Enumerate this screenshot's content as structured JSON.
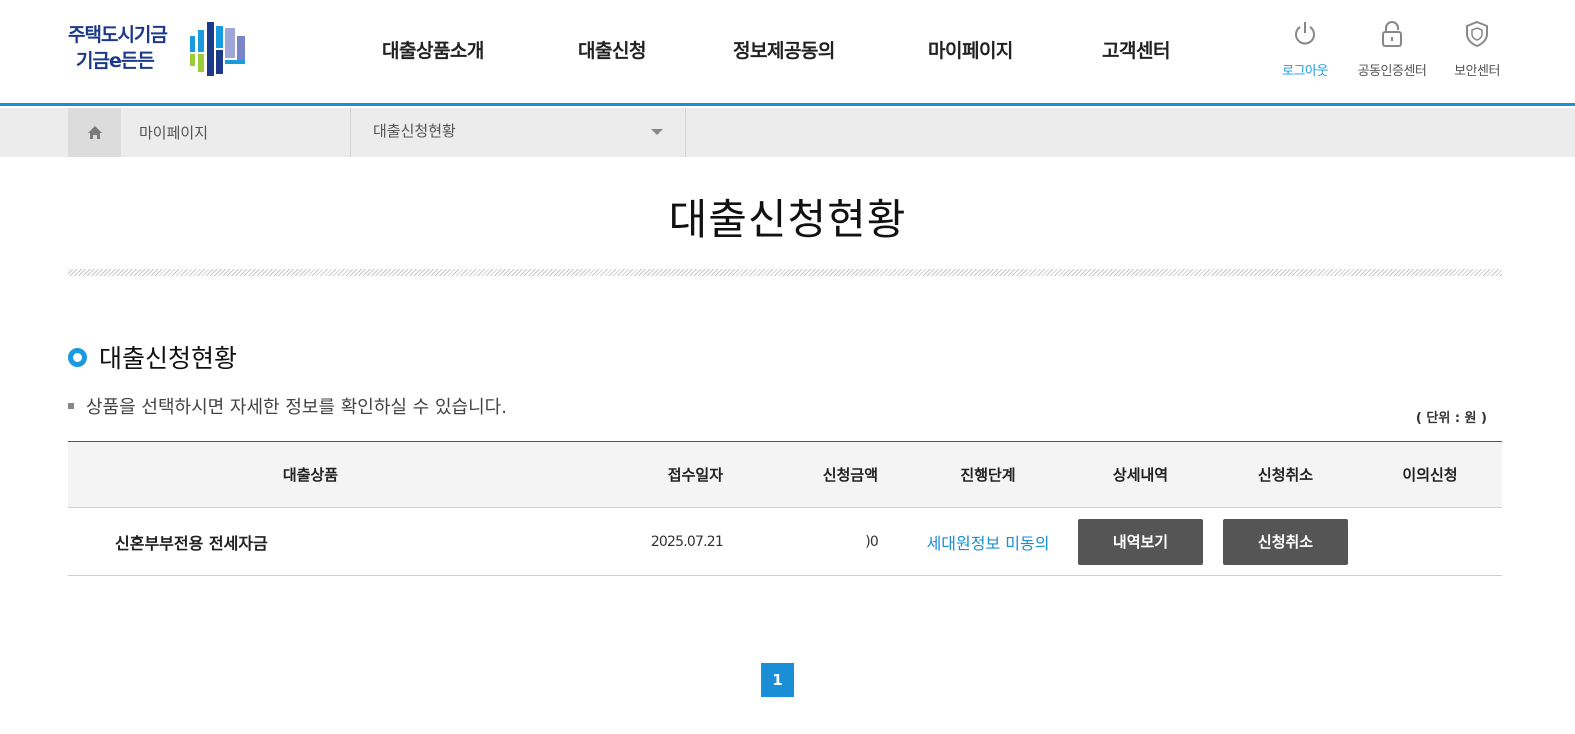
{
  "header": {
    "logo": {
      "line1": "주택도시기금",
      "line2": "기금e든든"
    },
    "nav": [
      "대출상품소개",
      "대출신청",
      "정보제공동의",
      "마이페이지",
      "고객센터"
    ],
    "util": [
      {
        "label": "로그아웃",
        "icon": "power-icon"
      },
      {
        "label": "공동인증센터",
        "icon": "lock-icon"
      },
      {
        "label": "보안센터",
        "icon": "shield-icon"
      }
    ]
  },
  "breadcrumb": {
    "level1": "마이페이지",
    "level2": "대출신청현황"
  },
  "page": {
    "title": "대출신청현황",
    "section_title": "대출신청현황",
    "description": "상품을 선택하시면 자세한 정보를 확인하실 수 있습니다.",
    "unit": "( 단위 : 원 )"
  },
  "table": {
    "headers": [
      "대출상품",
      "접수일자",
      "신청금액",
      "진행단계",
      "상세내역",
      "신청취소",
      "이의신청"
    ],
    "rows": [
      {
        "product": "신혼부부전용 전세자금",
        "date": "2025.07.21",
        "amount": ")0",
        "status": "세대원정보 미동의",
        "detail_button": "내역보기",
        "cancel_button": "신청취소",
        "appeal": ""
      }
    ]
  },
  "pagination": {
    "current": "1"
  },
  "colors": {
    "accent": "#1a8fd8",
    "button": "#555555",
    "status_link": "#1a8fd0"
  }
}
